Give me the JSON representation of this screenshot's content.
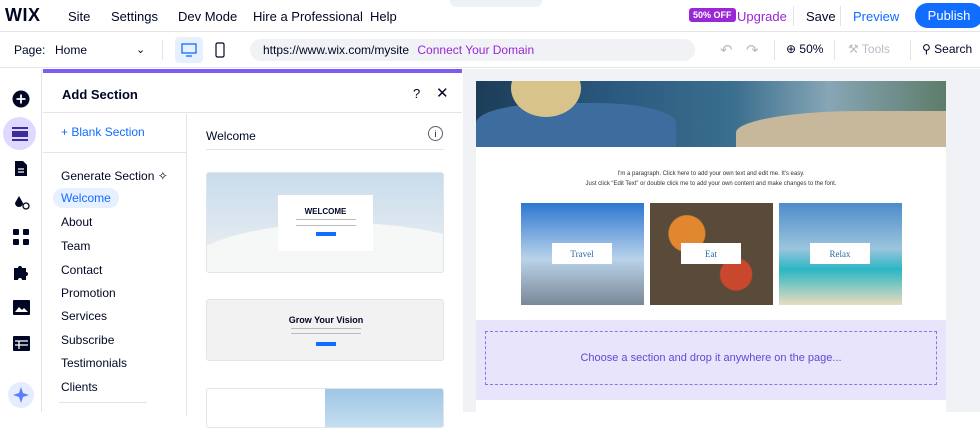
{
  "topbar": {
    "logo": "WIX",
    "nav": [
      "Site",
      "Settings",
      "Dev Mode",
      "Hire a Professional",
      "Help"
    ],
    "upgrade_badge": "50% OFF",
    "upgrade_label": "Upgrade",
    "save_label": "Save",
    "preview_label": "Preview",
    "publish_label": "Publish"
  },
  "toolbar": {
    "page_label": "Page:",
    "page_value": "Home",
    "url": "https://www.wix.com/mysite",
    "connect_domain": "Connect Your Domain",
    "zoom": "50%",
    "tools_label": "Tools",
    "search_label": "Search"
  },
  "panel": {
    "title": "Add Section",
    "blank_section": "+ Blank Section",
    "categories": [
      "Generate Section",
      "Welcome",
      "About",
      "Team",
      "Contact",
      "Promotion",
      "Services",
      "Subscribe",
      "Testimonials",
      "Clients"
    ],
    "active_category": "Welcome",
    "preview_title": "Welcome",
    "thumb1_title": "WELCOME",
    "thumb2_title": "Grow Your Vision"
  },
  "canvas": {
    "paragraph_line1": "I'm a paragraph. Click here to add your own text and edit me. It's easy.",
    "paragraph_line2": "Just click “Edit Text” or double click me to add your own content and make changes to the font.",
    "tiles": [
      "Travel",
      "Eat",
      "Relax"
    ],
    "dropzone_text": "Choose a section and drop it anywhere on the page..."
  },
  "colors": {
    "accent": "#116dff",
    "upgrade": "#9a27d5",
    "panel_accent": "#7d5cf0",
    "dropzone": "#e8e4fb"
  }
}
